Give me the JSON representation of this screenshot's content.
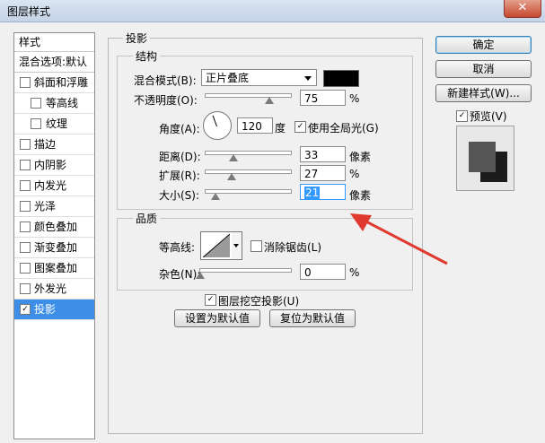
{
  "window": {
    "title": "图层样式",
    "close_label": "✕"
  },
  "left_panel": {
    "header": "样式",
    "blend": "混合选项:默认",
    "items": [
      {
        "label": "斜面和浮雕",
        "checked": false,
        "indent": false
      },
      {
        "label": "等高线",
        "checked": false,
        "indent": true
      },
      {
        "label": "纹理",
        "checked": false,
        "indent": true
      },
      {
        "label": "描边",
        "checked": false,
        "indent": false
      },
      {
        "label": "内阴影",
        "checked": false,
        "indent": false
      },
      {
        "label": "内发光",
        "checked": false,
        "indent": false
      },
      {
        "label": "光泽",
        "checked": false,
        "indent": false
      },
      {
        "label": "颜色叠加",
        "checked": false,
        "indent": false
      },
      {
        "label": "渐变叠加",
        "checked": false,
        "indent": false
      },
      {
        "label": "图案叠加",
        "checked": false,
        "indent": false
      },
      {
        "label": "外发光",
        "checked": false,
        "indent": false
      },
      {
        "label": "投影",
        "checked": true,
        "indent": false,
        "active": true
      }
    ]
  },
  "drop_shadow": {
    "section_title": "投影",
    "structure": {
      "title": "结构",
      "blend_mode_label": "混合模式(B):",
      "blend_mode_value": "正片叠底",
      "shadow_color": "#000000",
      "opacity_label": "不透明度(O):",
      "opacity_value": "75",
      "opacity_unit": "%",
      "angle_label": "角度(A):",
      "angle_value": "120",
      "angle_unit": "度",
      "global_light_label": "使用全局光(G)",
      "global_light_checked": true,
      "distance_label": "距离(D):",
      "distance_value": "33",
      "distance_unit": "像素",
      "spread_label": "扩展(R):",
      "spread_value": "27",
      "spread_unit": "%",
      "size_label": "大小(S):",
      "size_value": "21",
      "size_unit": "像素"
    },
    "quality": {
      "title": "品质",
      "contour_label": "等高线:",
      "anti_alias_label": "消除锯齿(L)",
      "anti_alias_checked": false,
      "noise_label": "杂色(N):",
      "noise_value": "0",
      "noise_unit": "%"
    },
    "knockout_label": "图层挖空投影(U)",
    "knockout_checked": true,
    "set_default_label": "设置为默认值",
    "reset_default_label": "复位为默认值"
  },
  "right_panel": {
    "ok_label": "确定",
    "cancel_label": "取消",
    "new_style_label": "新建样式(W)...",
    "preview_label": "预览(V)",
    "preview_checked": true
  },
  "colors": {
    "accent": "#3d8ee6",
    "arrow": "#e03a30"
  }
}
